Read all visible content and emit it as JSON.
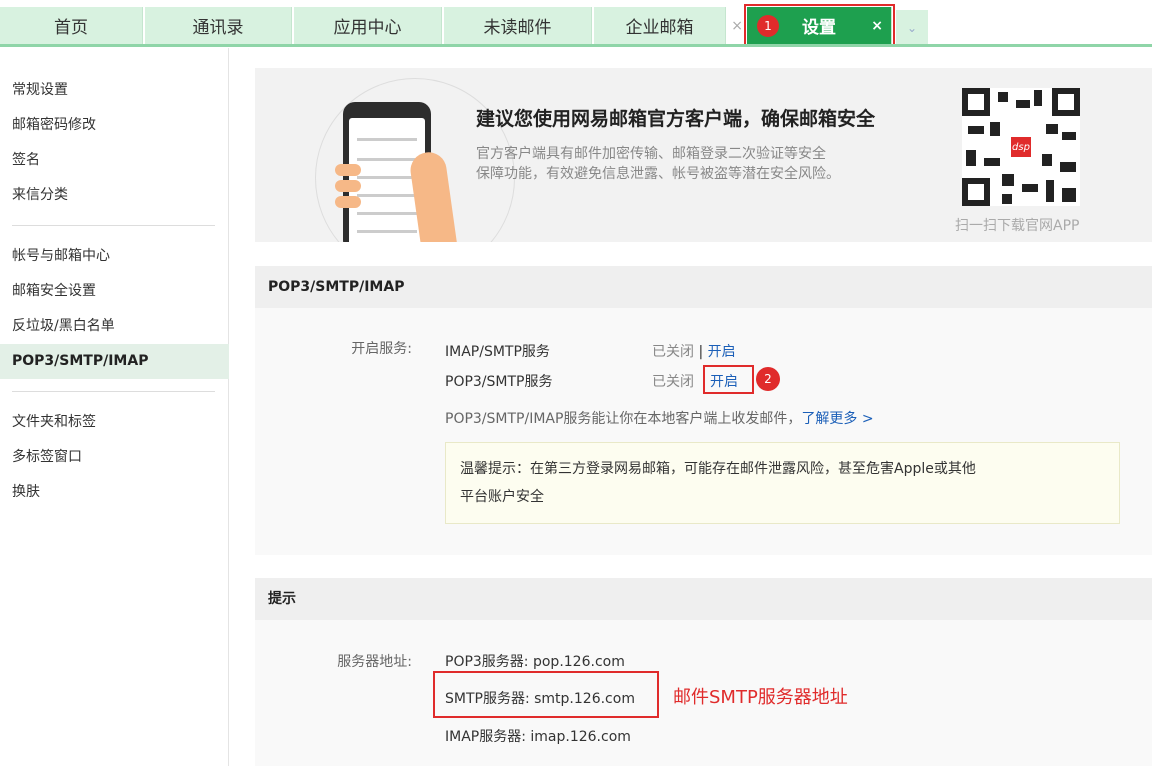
{
  "tabs": [
    {
      "label": "首页"
    },
    {
      "label": "通讯录"
    },
    {
      "label": "应用中心"
    },
    {
      "label": "未读邮件"
    },
    {
      "label": "企业邮箱",
      "close": "×"
    },
    {
      "label": "设置",
      "close": "×",
      "step": "1"
    }
  ],
  "sidebar": {
    "group1": [
      "常规设置",
      "邮箱密码修改",
      "签名",
      "来信分类"
    ],
    "group2": [
      "帐号与邮箱中心",
      "邮箱安全设置",
      "反垃圾/黑白名单",
      "POP3/SMTP/IMAP"
    ],
    "group3": [
      "文件夹和标签",
      "多标签窗口",
      "换肤"
    ]
  },
  "banner": {
    "title": "建议您使用网易邮箱官方客户端，确保邮箱安全",
    "desc_line1": "官方客户端具有邮件加密传输、邮箱登录二次验证等安全",
    "desc_line2": "保障功能，有效避免信息泄露、帐号被盗等潜在安全风险。",
    "qr_label": "扫一扫下载官网APP",
    "qr_logo": "dsp"
  },
  "pop_section": {
    "title": "POP3/SMTP/IMAP",
    "service_label": "开启服务:",
    "imap_name": "IMAP/SMTP服务",
    "imap_status": "已关闭",
    "imap_sep": "|",
    "imap_action": "开启",
    "pop_name": "POP3/SMTP服务",
    "pop_status": "已关闭",
    "pop_action": "开启",
    "pop_step": "2",
    "info": "POP3/SMTP/IMAP服务能让你在本地客户端上收发邮件，",
    "info_link": "了解更多 >",
    "notice_line1": "温馨提示：在第三方登录网易邮箱，可能存在邮件泄露风险，甚至危害Apple或其他",
    "notice_line2": "平台账户安全"
  },
  "tips_section": {
    "title": "提示",
    "server_label": "服务器地址:",
    "pop3": "POP3服务器: pop.126.com",
    "smtp": "SMTP服务器: smtp.126.com",
    "imap": "IMAP服务器: imap.126.com",
    "annotation": "邮件SMTP服务器地址"
  },
  "colors": {
    "accent": "#1ea04f",
    "tab_bg": "#d8f2e0",
    "highlight": "#e02b2b",
    "link": "#1b5fb8"
  }
}
